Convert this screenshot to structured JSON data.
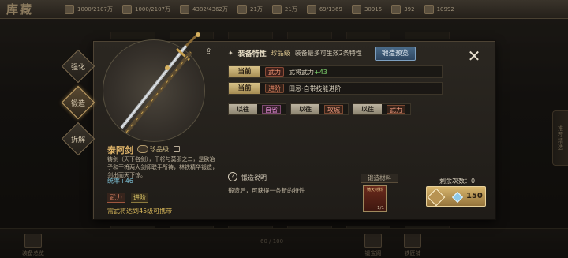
{
  "screen": {
    "title": "库藏"
  },
  "topbar": {
    "resources": [
      "1000/2107万",
      "1000/2107万",
      "4382/4362万",
      "21万",
      "21万",
      "69/1369",
      "30915",
      "392",
      "10992"
    ]
  },
  "bottom": {
    "left_label": "装备总览",
    "mid_left_label": "锻宝阁",
    "mid_right_label": "铁匠铺",
    "pager": "60 / 100"
  },
  "side_tab": "推荐精选",
  "tabs": {
    "strengthen": "强化",
    "forge": "锻造",
    "dismantle": "拆解"
  },
  "weapon": {
    "name": "泰阿剑",
    "quality": "珍品级",
    "desc": "铸剑（天下名剑），干将与莫邪之二，是欧冶子和干将两大剑师联手所铸，林铁精华锻造，剑出而天下惊。",
    "stat_label": "统率",
    "stat_value": "+46",
    "tags": [
      "武力",
      "进阶"
    ],
    "requirement": "需武将达到45级可携带"
  },
  "feature": {
    "title": "装备特性",
    "quality": "珍品级",
    "note": "装备最多可生效2条特性",
    "preview_button": "锻造预览"
  },
  "current": [
    {
      "label": "当前",
      "badge": "武力",
      "text": "武将武力",
      "plus": "+43"
    },
    {
      "label": "当前",
      "badge": "进阶",
      "text": "田忌·自带技能进阶",
      "plus": ""
    }
  ],
  "past": [
    {
      "label": "以往",
      "badge": "自省"
    },
    {
      "label": "以往",
      "badge": "攻城"
    },
    {
      "label": "以往",
      "badge": "武力"
    }
  ],
  "forge_info": {
    "help_title": "锻造说明",
    "help_desc": "锻造后，可获得一条新的特性",
    "material_label": "锻造材料",
    "material_name": "铸天材料",
    "material_count": "1/1",
    "remaining": "剩余次数：0",
    "cost": "150"
  }
}
